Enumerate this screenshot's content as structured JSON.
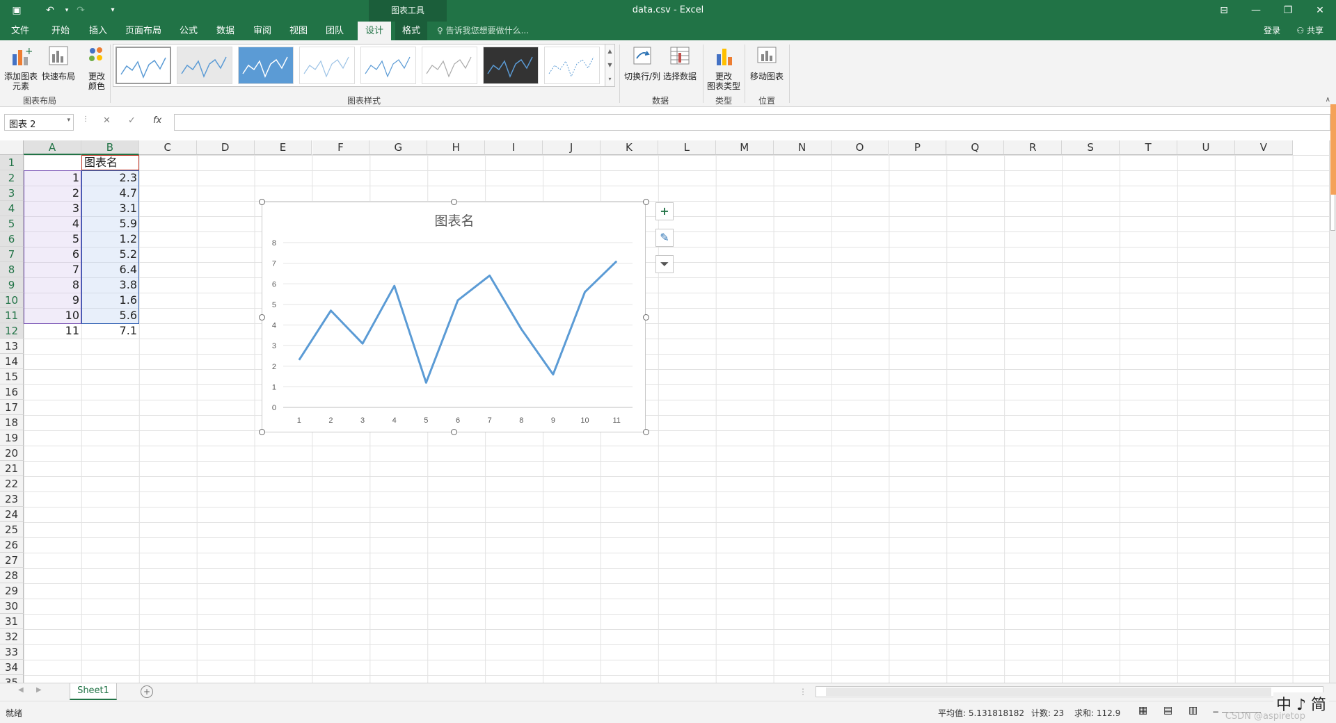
{
  "app": {
    "title": "data.csv - Excel",
    "tools_tab": "图表工具",
    "login": "登录",
    "share": "共享"
  },
  "menu": {
    "tabs": [
      "文件",
      "开始",
      "插入",
      "页面布局",
      "公式",
      "数据",
      "审阅",
      "视图",
      "团队",
      "设计",
      "格式"
    ],
    "active": "设计",
    "tell_me": "告诉我您想要做什么..."
  },
  "ribbon": {
    "add_element": "添加图表\n元素",
    "quick_layout": "快速布局",
    "change_color": "更改\n颜色",
    "group_layout": "图表布局",
    "group_styles": "图表样式",
    "switch_row_col": "切换行/列",
    "select_data": "选择数据",
    "group_data": "数据",
    "change_type": "更改\n图表类型",
    "group_type": "类型",
    "move_chart": "移动图表",
    "group_location": "位置"
  },
  "formula_bar": {
    "name_box": "图表 2",
    "fx": "fx",
    "value": ""
  },
  "columns": [
    "A",
    "B",
    "C",
    "D",
    "E",
    "F",
    "G",
    "H",
    "I",
    "J",
    "K",
    "L",
    "M",
    "N",
    "O",
    "P",
    "Q",
    "R",
    "S",
    "T",
    "U",
    "V"
  ],
  "rows": [
    "1",
    "2",
    "3",
    "4",
    "5",
    "6",
    "7",
    "8",
    "9",
    "10",
    "11",
    "12",
    "13",
    "14",
    "15",
    "16",
    "17",
    "18",
    "19",
    "20",
    "21",
    "22",
    "23",
    "24",
    "25",
    "26",
    "27",
    "28",
    "29",
    "30",
    "31",
    "32",
    "33",
    "34",
    "35"
  ],
  "table": {
    "header_b": "图表名",
    "col_a": [
      "1",
      "2",
      "3",
      "4",
      "5",
      "6",
      "7",
      "8",
      "9",
      "10",
      "11"
    ],
    "col_b": [
      "2.3",
      "4.7",
      "3.1",
      "5.9",
      "1.2",
      "5.2",
      "6.4",
      "3.8",
      "1.6",
      "5.6",
      "7.1"
    ]
  },
  "chart_data": {
    "type": "line",
    "title": "图表名",
    "x": [
      1,
      2,
      3,
      4,
      5,
      6,
      7,
      8,
      9,
      10,
      11
    ],
    "series": [
      {
        "values": [
          2.3,
          4.7,
          3.1,
          5.9,
          1.2,
          5.2,
          6.4,
          3.8,
          1.6,
          5.6,
          7.1
        ],
        "color": "#5b9bd5"
      }
    ],
    "xlabel": "",
    "ylabel": "",
    "ylim": [
      0,
      8
    ],
    "yticks": [
      0,
      1,
      2,
      3,
      4,
      5,
      6,
      7,
      8
    ],
    "grid": true,
    "legend": "none"
  },
  "sheet": {
    "tab": "Sheet1"
  },
  "status": {
    "ready": "就绪",
    "average": "平均值: 5.131818182",
    "count": "计数: 23",
    "sum": "求和: 112.9"
  },
  "ime": "中 ♪ 简",
  "watermark": "CSDN @aspiretop"
}
